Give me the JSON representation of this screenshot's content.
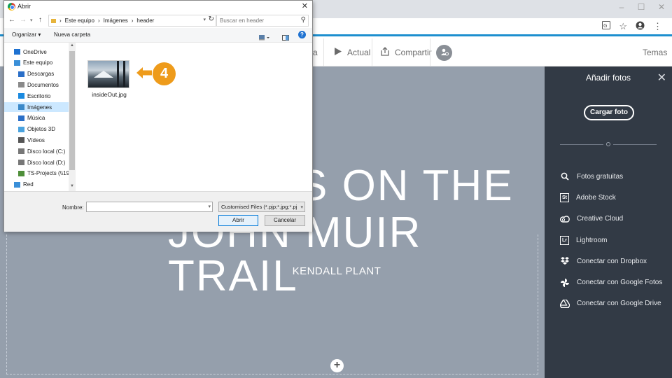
{
  "browser": {
    "minimize_glyph": "–",
    "maximize_glyph": "☐",
    "close_glyph": "✕",
    "addr_icons": [
      "translate-icon",
      "star-icon",
      "account-icon",
      "menu-icon"
    ]
  },
  "spark_toolbar": {
    "preview_label": "Actual",
    "share_label": "Compartir",
    "themes_label": "Temas",
    "partial_left_label": "a"
  },
  "canvas": {
    "headline_line1": "S ON THE",
    "headline_line2": "JOHN MUIR TRAIL",
    "byline": "KENDALL PLANT",
    "add_glyph": "+"
  },
  "panel": {
    "title": "Añadir fotos",
    "close_glyph": "✕",
    "upload_label": "Cargar foto",
    "sources": [
      {
        "label": "Fotos gratuitas",
        "icon": "search-icon"
      },
      {
        "label": "Adobe Stock",
        "icon": "adobe-stock-icon",
        "glyph": "St"
      },
      {
        "label": "Creative Cloud",
        "icon": "creative-cloud-icon"
      },
      {
        "label": "Lightroom",
        "icon": "lightroom-icon",
        "glyph": "Lr"
      },
      {
        "label": "Conectar con Dropbox",
        "icon": "dropbox-icon"
      },
      {
        "label": "Conectar con Google Fotos",
        "icon": "google-photos-icon"
      },
      {
        "label": "Conectar con Google Drive",
        "icon": "google-drive-icon"
      }
    ]
  },
  "dialog": {
    "title": "Abrir",
    "close_glyph": "✕",
    "path": [
      "Este equipo",
      "Imágenes",
      "header"
    ],
    "search_placeholder": "Buscar en header",
    "organize_label": "Organizar ▾",
    "new_folder_label": "Nueva carpeta",
    "help_glyph": "?",
    "tree": [
      {
        "label": "OneDrive",
        "icon": "onedrive-icon",
        "color": "#1f72d1"
      },
      {
        "label": "Este equipo",
        "icon": "computer-icon",
        "color": "#3a8fd8"
      },
      {
        "label": "Descargas",
        "icon": "downloads-icon",
        "color": "#2a6fc8"
      },
      {
        "label": "Documentos",
        "icon": "documents-icon",
        "color": "#8a8a8a"
      },
      {
        "label": "Escritorio",
        "icon": "desktop-icon",
        "color": "#1b8ae0"
      },
      {
        "label": "Imágenes",
        "icon": "pictures-icon",
        "color": "#3b89c9",
        "selected": true
      },
      {
        "label": "Música",
        "icon": "music-icon",
        "color": "#2a6fc8"
      },
      {
        "label": "Objetos 3D",
        "icon": "objects3d-icon",
        "color": "#4aa3df"
      },
      {
        "label": "Vídeos",
        "icon": "videos-icon",
        "color": "#555555"
      },
      {
        "label": "Disco local (C:)",
        "icon": "drive-icon",
        "color": "#777777"
      },
      {
        "label": "Disco local (D:)",
        "icon": "drive-icon",
        "color": "#777777"
      },
      {
        "label": "TS-Projects (\\\\19",
        "icon": "network-drive-icon",
        "color": "#4f8f3a"
      },
      {
        "label": "Red",
        "icon": "network-icon",
        "color": "#3a8fd8"
      }
    ],
    "file": {
      "name": "insideOut.jpg"
    },
    "callout_number": "4",
    "name_label": "Nombre:",
    "name_value": "",
    "filter_label": "Customised Files (*.pjp;*.jpg;*.pj",
    "open_label": "Abrir",
    "cancel_label": "Cancelar"
  },
  "colors": {
    "accent_blue": "#1d8fcf",
    "panel_bg": "#323a45",
    "canvas_bg": "#959fac",
    "callout_orange": "#ee9b1b"
  }
}
